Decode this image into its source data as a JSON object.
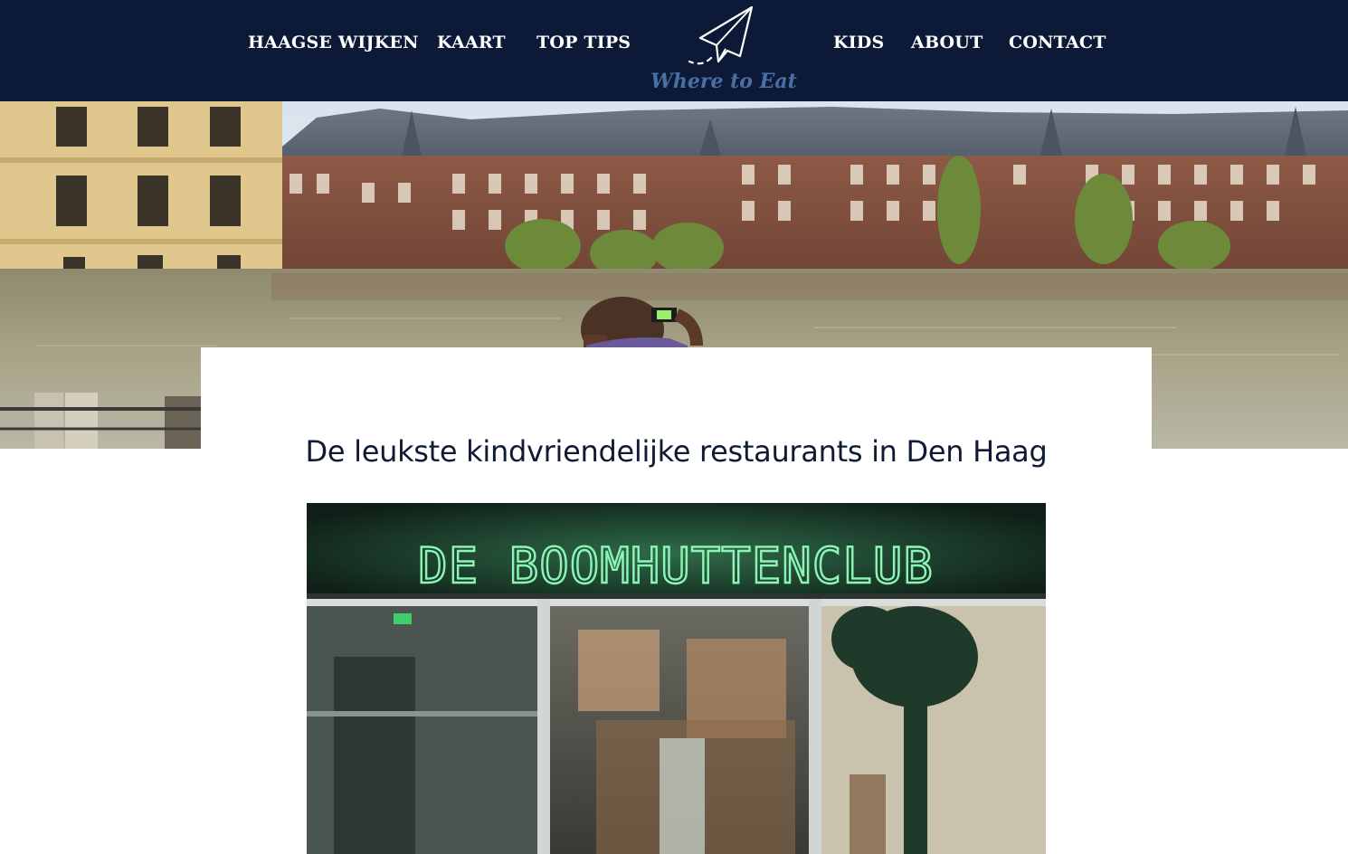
{
  "nav": {
    "left_items": [
      {
        "label": "HAAGSE WIJKEN"
      },
      {
        "label": "KAART"
      },
      {
        "label": "TOP TIPS"
      }
    ],
    "right_items": [
      {
        "label": "KIDS"
      },
      {
        "label": "ABOUT"
      },
      {
        "label": "CONTACT"
      }
    ],
    "logo_text": "Where to Eat"
  },
  "hero": {
    "emojis": [
      "🧸",
      "🍭",
      "🎀",
      "🧢",
      "🦕",
      "🥞",
      "🤡",
      "🛹",
      "🚀",
      "⭐"
    ]
  },
  "article": {
    "title": "De leukste kindvriendelijke restaurants in Den Haag"
  },
  "photo": {
    "sign_text": "DE BOOMHUTTENCLUB"
  },
  "colors": {
    "nav_bg": "#0c1a38",
    "nav_text": "#ffffff",
    "logo_blue": "#4a6fa5",
    "title_text": "#0f1a34",
    "neon_green": "#8cf5b6"
  }
}
